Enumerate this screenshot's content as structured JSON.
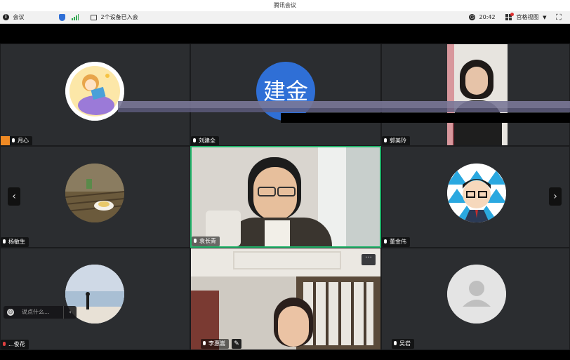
{
  "window": {
    "title": "腾讯会议"
  },
  "toolbar": {
    "meeting_label": "会议",
    "info_icon": "info-icon",
    "devices_text": "2个设备已入会",
    "timer": "20:42",
    "view_label": "宫格视图",
    "fullscreen_icon": "fullscreen-icon"
  },
  "participants": [
    {
      "name": "月心",
      "avatar": "cartoon-girl-reading"
    },
    {
      "name": "刘建全",
      "avatar_text": "建金",
      "avatar_color": "#2f6fd6"
    },
    {
      "name": "郭美玲",
      "avatar": "video"
    },
    {
      "name": "杨敏生",
      "avatar": "tea-photo"
    },
    {
      "name": "袁长青",
      "avatar": "video",
      "active": true
    },
    {
      "name": "董金伟",
      "avatar": "cartoon-man-glasses"
    },
    {
      "name": "...俊花",
      "avatar": "beach-photo"
    },
    {
      "name": "李惠嵩",
      "avatar": "video"
    },
    {
      "name": "吴岩",
      "avatar": "default-user"
    }
  ],
  "chat": {
    "placeholder": "说点什么..."
  },
  "colors": {
    "active_border": "#22b36a",
    "tile_bg": "#2b2d30",
    "mic_muted": "#e04040"
  }
}
